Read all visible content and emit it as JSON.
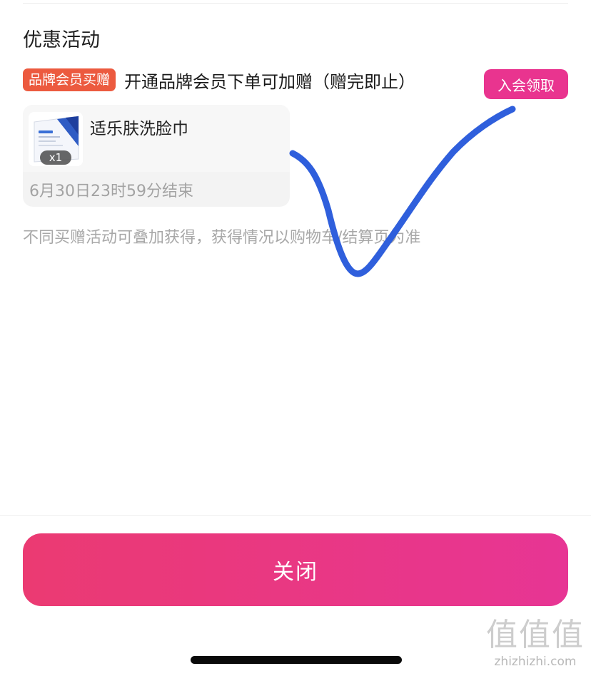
{
  "activities": {
    "title": "优惠活动",
    "promo_tag": "品牌会员买赠",
    "promo_description": "开通品牌会员下单可加赠（赠完即止）",
    "join_button_label": "入会领取",
    "gift": {
      "name": "适乐肤洗脸巾",
      "quantity": "x1",
      "end_time": "6月30日23时59分结束"
    },
    "note": "不同买赠活动可叠加获得，获得情况以购物车/结算页为准"
  },
  "footer": {
    "close_button_label": "关闭"
  },
  "watermark": {
    "glyphs": "值值值",
    "url": "zhizhizhi.com"
  },
  "colors": {
    "promo_tag": "#ec5a3f",
    "join_button": "#e9348f",
    "close_button_start": "#eb3a72",
    "close_button_end": "#e73594",
    "checkmark_stroke": "#2f5fdc"
  },
  "icons": {
    "product_thumbnail": "product-package-image",
    "annotation": "hand-drawn-checkmark"
  }
}
